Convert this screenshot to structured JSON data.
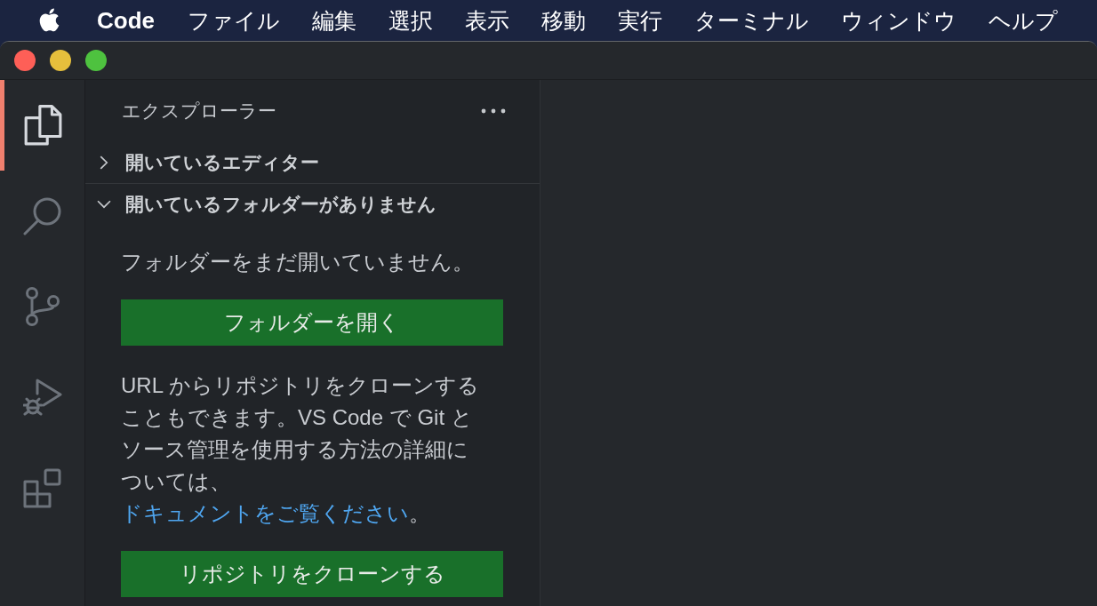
{
  "menu_bar": {
    "app_name": "Code",
    "items": [
      "ファイル",
      "編集",
      "選択",
      "表示",
      "移動",
      "実行",
      "ターミナル",
      "ウィンドウ",
      "ヘルプ"
    ]
  },
  "activity_bar": {
    "items": [
      {
        "kind": "explorer",
        "selected": true
      },
      {
        "kind": "search",
        "selected": false
      },
      {
        "kind": "source_control",
        "selected": false
      },
      {
        "kind": "run_debug",
        "selected": false
      },
      {
        "kind": "extensions",
        "selected": false
      }
    ]
  },
  "sidebar": {
    "title": "エクスプローラー",
    "sections": [
      {
        "title": "開いているエディター",
        "expanded": false
      },
      {
        "title": "開いているフォルダーがありません",
        "expanded": true,
        "body": [
          {
            "kind": "text",
            "text": "フォルダーをまだ開いていません。"
          },
          {
            "kind": "button",
            "label": "フォルダーを開く"
          },
          {
            "kind": "text",
            "text": "URL からリポジトリをクローンすることもできます。VS Code で Git とソース管理を使用する方法の詳細については、",
            "link": "ドキュメントをご覧ください",
            "after": "。"
          },
          {
            "kind": "button",
            "label": "リポジトリをクローンする"
          }
        ]
      }
    ]
  }
}
